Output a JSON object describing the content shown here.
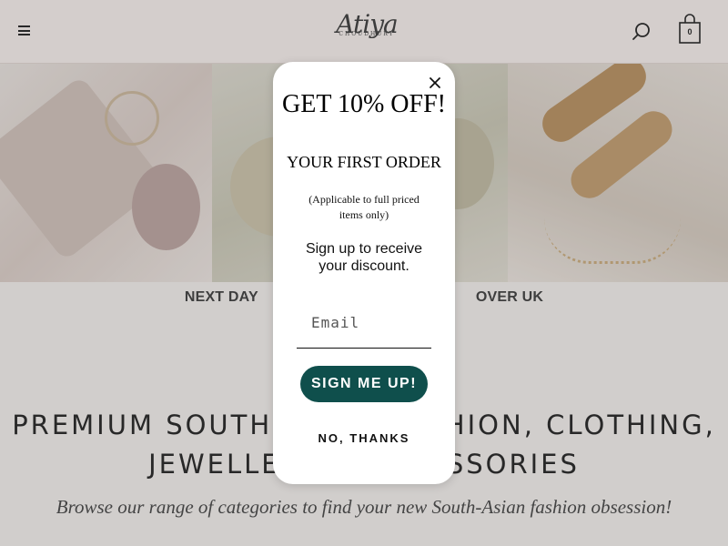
{
  "header": {
    "logo_script": "Atiya",
    "logo_sub": "CHOUDHURY",
    "cart_count": "0",
    "icons": {
      "menu": "hamburger-icon",
      "search": "search-icon",
      "cart": "shopping-bag-icon"
    }
  },
  "shipping_banner": {
    "left": "NEXT DAY",
    "right": "OVER UK"
  },
  "headline": {
    "line1": "PREMIUM SOUTH-ASIAN FASHION, CLOTHING,",
    "line2": "JEWELLERY & ACCESSORIES"
  },
  "subline": "Browse our range of categories to find your new South-Asian fashion obsession!",
  "modal": {
    "title": "GET 10% OFF!",
    "subtitle": "YOUR FIRST ORDER",
    "note": "(Applicable to full priced items only)",
    "description": "Sign up to receive your discount.",
    "email_placeholder": "Email",
    "signup_label": "SIGN ME UP!",
    "decline_label": "NO, THANKS"
  },
  "colors": {
    "accent": "#0f4f4c",
    "header_bg": "#f3ecea",
    "page_bg": "#efecea"
  }
}
